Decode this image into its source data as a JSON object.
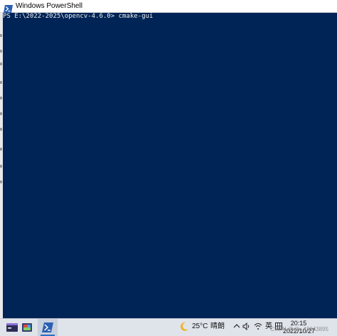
{
  "window": {
    "title": "Windows PowerShell"
  },
  "console": {
    "prompt": "PS E:\\2022-2025\\opencv-4.6.0> ",
    "command": "cmake-gui",
    "background": "#012456",
    "foreground": "#eeedf0"
  },
  "taskbar": {
    "apps": [
      {
        "icon": "terminal-app-icon",
        "active": false
      },
      {
        "icon": "colorful-app-icon",
        "active": false
      },
      {
        "icon": "powershell-icon",
        "active": true
      }
    ],
    "weather": {
      "icon": "moon-icon",
      "temperature": "25°C",
      "condition": "晴朗"
    },
    "tray": {
      "chevron_icon": "chevron-up-icon",
      "volume_icon": "speaker-icon",
      "wifi_icon": "wifi-icon",
      "ime_label": "英",
      "ime_icon": "keyboard-grid-icon"
    },
    "clock": {
      "time": "20:15",
      "date": "2022/10/27"
    }
  },
  "watermark": "CSDN @dh_42843895"
}
